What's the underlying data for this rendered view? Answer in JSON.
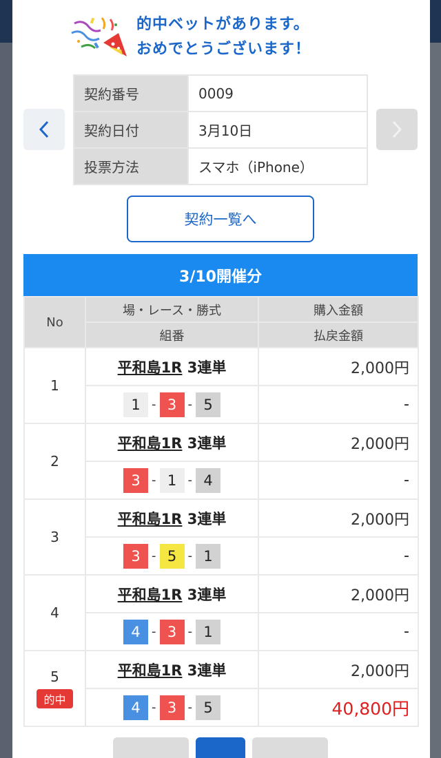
{
  "congrats": {
    "line1": "的中ベットがあります。",
    "line2": "おめでとうございます！"
  },
  "contract": {
    "rows": [
      {
        "label": "契約番号",
        "value": "0009"
      },
      {
        "label": "契約日付",
        "value": "3月10日"
      },
      {
        "label": "投票方法",
        "value": "スマホ（iPhone）"
      }
    ]
  },
  "list_button": "契約一覧へ",
  "bets": {
    "section_title": "3/10開催分",
    "headers": {
      "no": "No",
      "race": "場・レース・勝式",
      "combo": "組番",
      "purchase": "購入金額",
      "payout": "払戻金額"
    },
    "rows": [
      {
        "no": "1",
        "venue": "平和島1R",
        "type": "3連単",
        "amount": "2,000円",
        "payout": "-",
        "hit": false,
        "balls": [
          {
            "n": "1",
            "color": "#eeeeee"
          },
          {
            "n": "3",
            "color": "#ef5350"
          },
          {
            "n": "5",
            "color": "#d2d2d2"
          }
        ]
      },
      {
        "no": "2",
        "venue": "平和島1R",
        "type": "3連単",
        "amount": "2,000円",
        "payout": "-",
        "hit": false,
        "balls": [
          {
            "n": "3",
            "color": "#ef5350"
          },
          {
            "n": "1",
            "color": "#eeeeee"
          },
          {
            "n": "4",
            "color": "#d2d2d2"
          }
        ]
      },
      {
        "no": "3",
        "venue": "平和島1R",
        "type": "3連単",
        "amount": "2,000円",
        "payout": "-",
        "hit": false,
        "balls": [
          {
            "n": "3",
            "color": "#ef5350"
          },
          {
            "n": "5",
            "color": "#f5e642"
          },
          {
            "n": "1",
            "color": "#d2d2d2"
          }
        ]
      },
      {
        "no": "4",
        "venue": "平和島1R",
        "type": "3連単",
        "amount": "2,000円",
        "payout": "-",
        "hit": false,
        "balls": [
          {
            "n": "4",
            "color": "#4a90e2"
          },
          {
            "n": "3",
            "color": "#ef5350"
          },
          {
            "n": "1",
            "color": "#d2d2d2"
          }
        ]
      },
      {
        "no": "5",
        "venue": "平和島1R",
        "type": "3連単",
        "amount": "2,000円",
        "payout": "40,800円",
        "hit": true,
        "hit_label": "的中",
        "balls": [
          {
            "n": "4",
            "color": "#4a90e2"
          },
          {
            "n": "3",
            "color": "#ef5350"
          },
          {
            "n": "5",
            "color": "#d2d2d2"
          }
        ]
      }
    ]
  },
  "colors": {
    "accent": "#1b66c9",
    "section_header": "#1b8af0",
    "win": "#e01e1e"
  }
}
